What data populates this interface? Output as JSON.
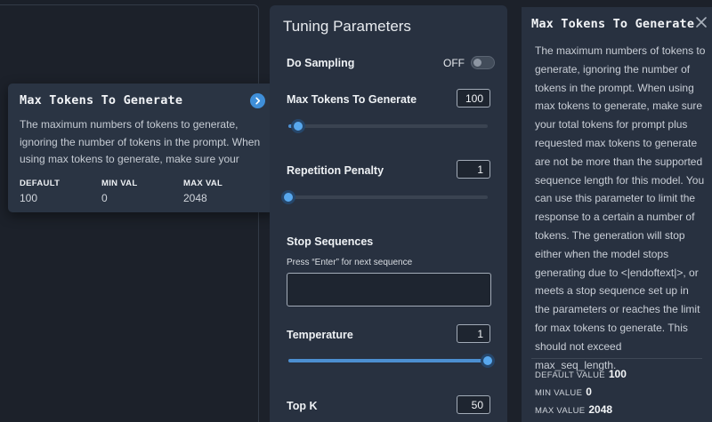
{
  "tooltip": {
    "title": "Max Tokens To Generate",
    "description": "The maximum numbers of tokens to generate, ignoring the number of tokens in the prompt. When using max tokens to generate, make sure your total…",
    "default_label": "DEFAULT",
    "default_value": "100",
    "min_label": "MIN VAL",
    "min_value": "0",
    "max_label": "MAX VAL",
    "max_value": "2048"
  },
  "panel": {
    "title": "Tuning Parameters",
    "do_sampling": {
      "label": "Do Sampling",
      "state": "OFF",
      "on": false
    },
    "max_tokens": {
      "label": "Max Tokens To Generate",
      "value": "100",
      "slider_fraction": 0.049
    },
    "repetition_penalty": {
      "label": "Repetition Penalty",
      "value": "1",
      "slider_fraction": 0.0
    },
    "stop_sequences": {
      "label": "Stop Sequences",
      "hint": "Press “Enter” for next sequence",
      "value": ""
    },
    "temperature": {
      "label": "Temperature",
      "value": "1",
      "slider_fraction": 1.0
    },
    "top_k": {
      "label": "Top K",
      "value": "50"
    }
  },
  "info": {
    "title": "Max Tokens To Generate",
    "description": "The maximum numbers of tokens to generate, ignoring the number of tokens in the prompt. When using max tokens to generate, make sure your total tokens for prompt plus requested max tokens to generate are not be more than the supported sequence length for this model. You can use this parameter to limit the response to a certain a number of tokens. The generation will stop either when the model stops generating due to <|endoftext|>, or meets a stop sequence set up in the parameters or reaches the limit for max tokens to generate. This should not exceed max_seq_length.",
    "default_label": "DEFAULT VALUE",
    "default_value": "100",
    "min_label": "MIN VALUE",
    "min_value": "0",
    "max_label": "MAX VALUE",
    "max_value": "2048"
  },
  "icons": {
    "tooltip_arrow": "chevron-right-icon",
    "close": "close-icon"
  },
  "colors": {
    "accent": "#4c8fd1",
    "panel": "#283140",
    "background": "#1c212a"
  }
}
